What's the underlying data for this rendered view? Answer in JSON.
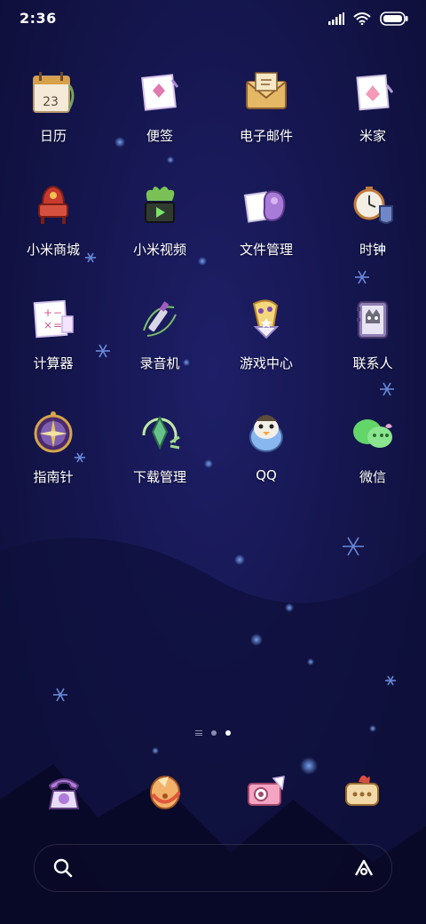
{
  "status": {
    "time": "2:36"
  },
  "apps": [
    {
      "label": "日历",
      "icon": "calendar-icon",
      "day": "23"
    },
    {
      "label": "便签",
      "icon": "notes-icon"
    },
    {
      "label": "电子邮件",
      "icon": "email-icon"
    },
    {
      "label": "米家",
      "icon": "mijia-icon"
    },
    {
      "label": "小米商城",
      "icon": "store-icon"
    },
    {
      "label": "小米视频",
      "icon": "video-icon"
    },
    {
      "label": "文件管理",
      "icon": "file-manager-icon"
    },
    {
      "label": "时钟",
      "icon": "clock-icon"
    },
    {
      "label": "计算器",
      "icon": "calculator-icon"
    },
    {
      "label": "录音机",
      "icon": "recorder-icon"
    },
    {
      "label": "游戏中心",
      "icon": "game-center-icon"
    },
    {
      "label": "联系人",
      "icon": "contacts-icon"
    },
    {
      "label": "指南针",
      "icon": "compass-icon"
    },
    {
      "label": "下载管理",
      "icon": "downloads-icon"
    },
    {
      "label": "QQ",
      "icon": "qq-icon"
    },
    {
      "label": "微信",
      "icon": "wechat-icon"
    }
  ],
  "dock": [
    "phone-icon",
    "browser-icon",
    "camera-icon",
    "messages-icon"
  ],
  "colors": {
    "background": "#15164f",
    "accent": "#8a8db8"
  }
}
